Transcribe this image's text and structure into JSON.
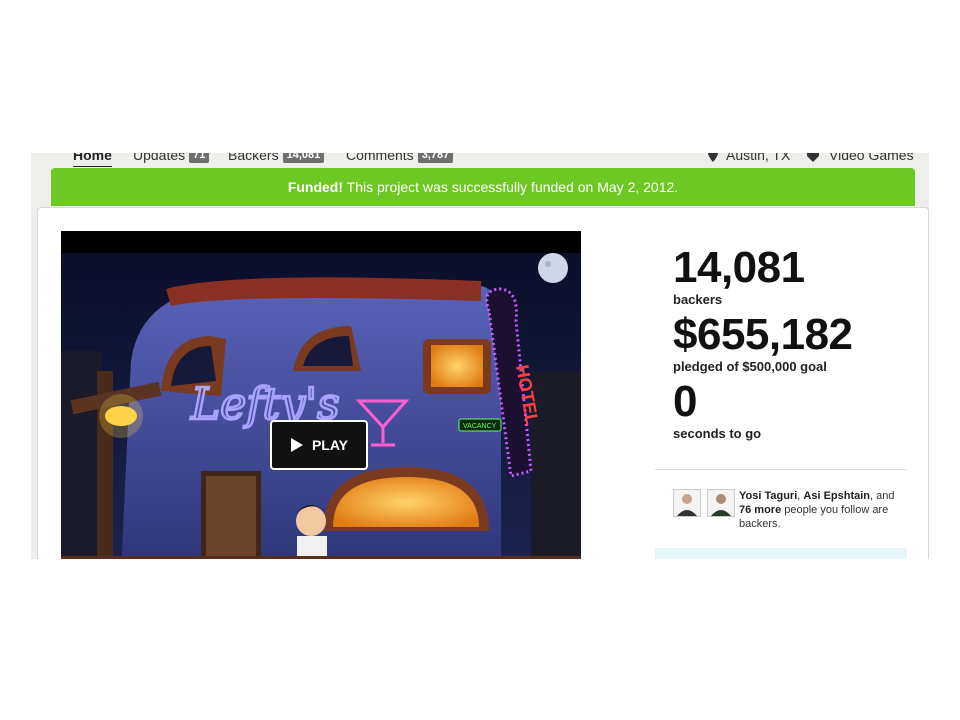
{
  "nav": {
    "items": [
      {
        "label": "Home",
        "badge": ""
      },
      {
        "label": "Updates",
        "badge": "71"
      },
      {
        "label": "Backers",
        "badge": "14,081"
      },
      {
        "label": "Comments",
        "badge": "3,787"
      }
    ],
    "location": "Austin, TX",
    "category": "Video Games"
  },
  "banner": {
    "strong": "Funded!",
    "text": " This project was successfully funded on May 2, 2012."
  },
  "video": {
    "play_label": "PLAY",
    "sign_text": "Lefty's",
    "hotel_text": "HOTEL",
    "vacancy_text": "VACANCY"
  },
  "stats": {
    "backers_value": "14,081",
    "backers_label": "backers",
    "pledged_value": "$655,182",
    "pledged_label": "pledged of $500,000 goal",
    "time_value": "0",
    "time_label": "seconds to go"
  },
  "friends": {
    "names": "Yosi Taguri",
    "sep1": ", ",
    "name2": "Asi Epshtain",
    "sep2": ",",
    "and": " and ",
    "more": "76 more",
    "rest": " people you follow are backers."
  },
  "colors": {
    "banner": "#6ec824",
    "badge": "#6f6f6f"
  }
}
